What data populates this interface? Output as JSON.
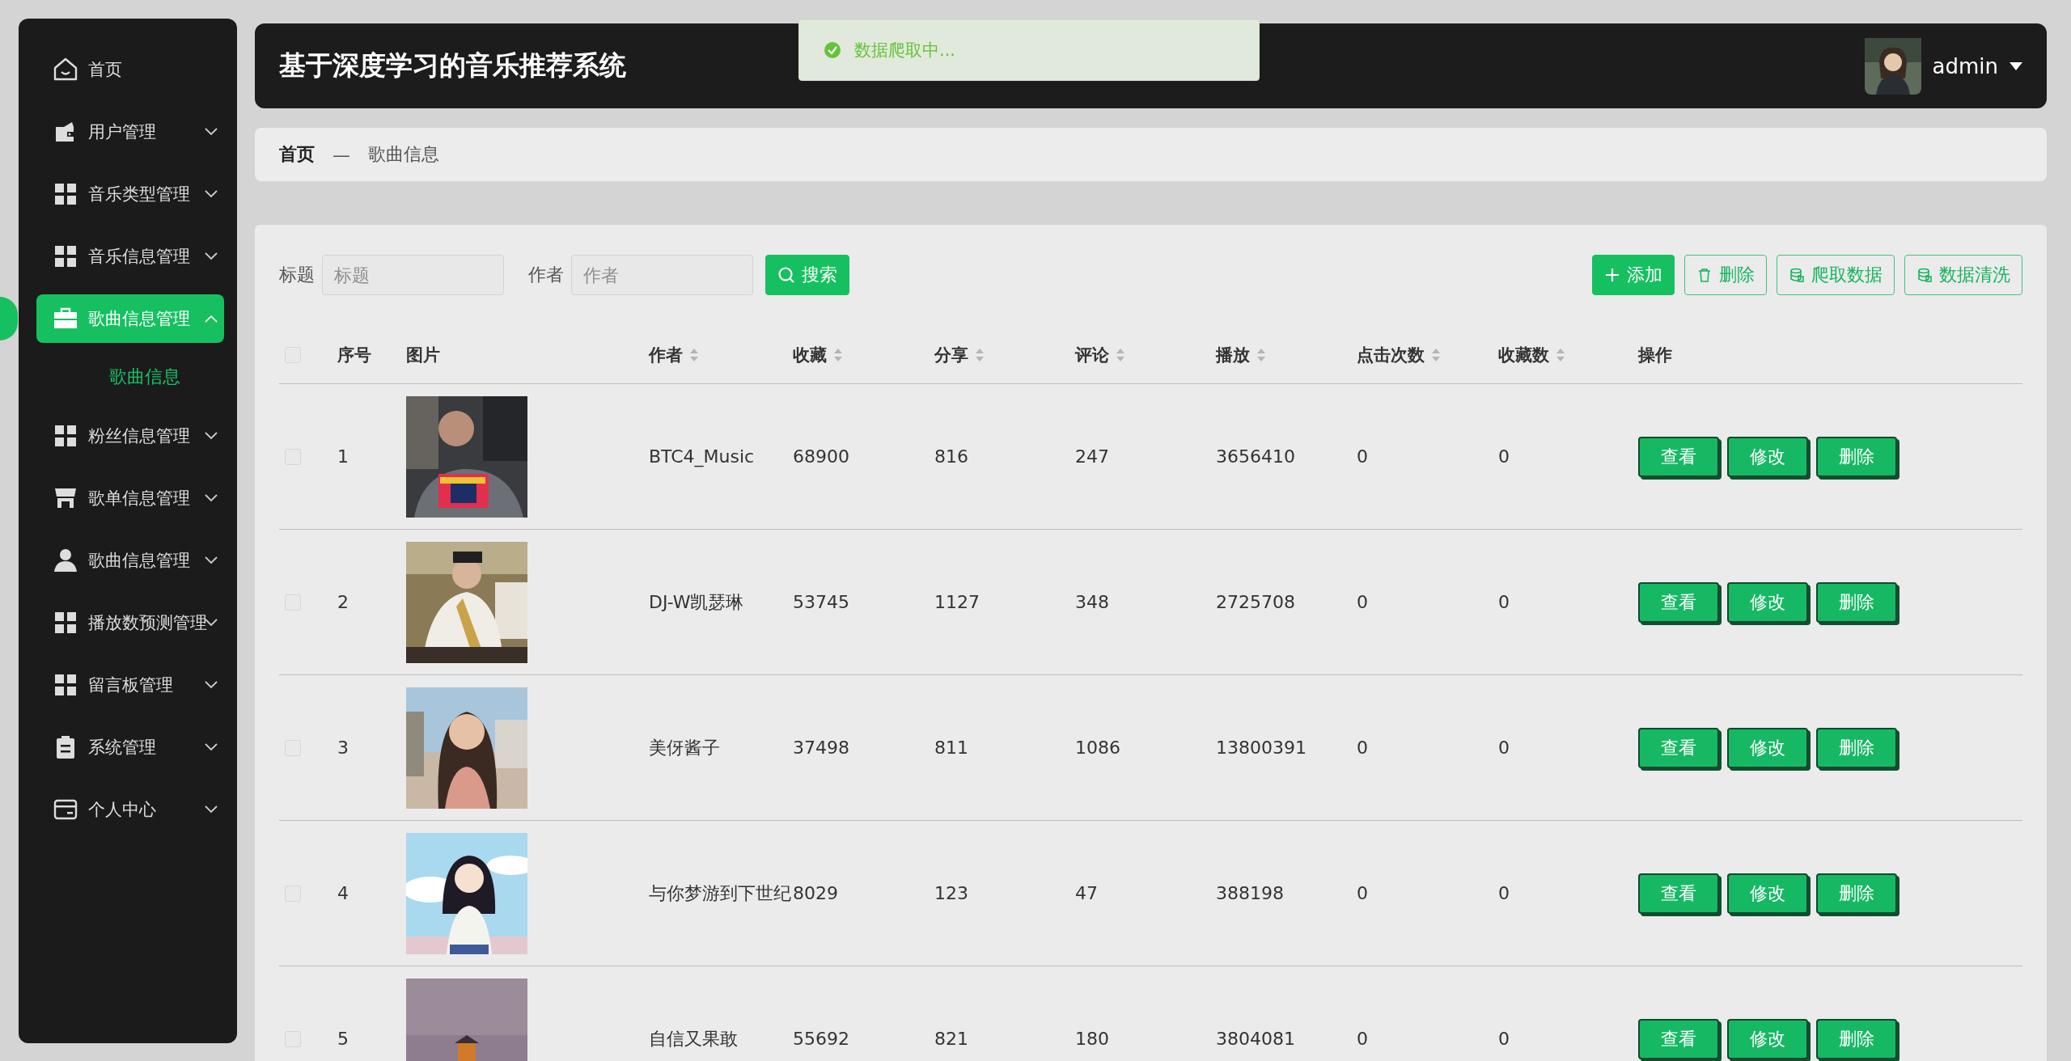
{
  "header": {
    "title": "基于深度学习的音乐推荐系统",
    "user": {
      "name": "admin"
    }
  },
  "toast": {
    "text": "数据爬取中..."
  },
  "breadcrumb": [
    {
      "label": "首页",
      "current": false
    },
    {
      "label": "歌曲信息",
      "current": true
    }
  ],
  "breadcrumb_separator": "—",
  "sidebar": {
    "items": [
      {
        "label": "首页",
        "kind": "home",
        "selected": false
      },
      {
        "label": "用户管理",
        "kind": "wallet",
        "selected": false,
        "expanded": false
      },
      {
        "label": "音乐类型管理",
        "kind": "grid",
        "selected": false,
        "expanded": false
      },
      {
        "label": "音乐信息管理",
        "kind": "grid",
        "selected": false,
        "expanded": false
      },
      {
        "label": "歌曲信息管理",
        "kind": "briefcase",
        "selected": true,
        "expanded": true,
        "children": [
          {
            "label": "歌曲信息",
            "selected": true
          }
        ]
      },
      {
        "label": "粉丝信息管理",
        "kind": "grid",
        "selected": false,
        "expanded": false
      },
      {
        "label": "歌单信息管理",
        "kind": "store",
        "selected": false,
        "expanded": false
      },
      {
        "label": "歌曲信息管理",
        "kind": "person",
        "selected": false,
        "expanded": false
      },
      {
        "label": "播放数预测管理",
        "kind": "grid",
        "selected": false,
        "expanded": false
      },
      {
        "label": "留言板管理",
        "kind": "grid",
        "selected": false,
        "expanded": false
      },
      {
        "label": "系统管理",
        "kind": "clipboard",
        "selected": false,
        "expanded": false
      },
      {
        "label": "个人中心",
        "kind": "card",
        "selected": false,
        "expanded": false
      }
    ]
  },
  "filters": [
    {
      "label": "标题",
      "placeholder": "标题"
    },
    {
      "label": "作者",
      "placeholder": "作者"
    }
  ],
  "search_button": "搜索",
  "toolbar": [
    {
      "label": "添加",
      "kind": "add"
    },
    {
      "label": "删除",
      "kind": "delete"
    },
    {
      "label": "爬取数据",
      "kind": "data"
    },
    {
      "label": "数据清洗",
      "kind": "data"
    }
  ],
  "table": {
    "select_all": {
      "selected": false
    },
    "columns": [
      {
        "label": "序号",
        "sortable": false
      },
      {
        "label": "图片",
        "sortable": false
      },
      {
        "label": "作者",
        "sortable": true
      },
      {
        "label": "收藏",
        "sortable": true
      },
      {
        "label": "分享",
        "sortable": true
      },
      {
        "label": "评论",
        "sortable": true
      },
      {
        "label": "播放",
        "sortable": true
      },
      {
        "label": "点击次数",
        "sortable": true
      },
      {
        "label": "收藏数",
        "sortable": true
      },
      {
        "label": "操作",
        "sortable": false
      }
    ],
    "rows": [
      {
        "selected": false,
        "cells": [
          "1",
          {
            "kind": "picture"
          },
          "BTC4_Music",
          "68900",
          "816",
          "247",
          "3656410",
          "0",
          "0"
        ],
        "actions": [
          "查看",
          "修改",
          "删除"
        ]
      },
      {
        "selected": false,
        "cells": [
          "2",
          {
            "kind": "picture"
          },
          "DJ-W凯瑟琳",
          "53745",
          "1127",
          "348",
          "2725708",
          "0",
          "0"
        ],
        "actions": [
          "查看",
          "修改",
          "删除"
        ]
      },
      {
        "selected": false,
        "cells": [
          "3",
          {
            "kind": "picture"
          },
          "美伢酱子",
          "37498",
          "811",
          "1086",
          "13800391",
          "0",
          "0"
        ],
        "actions": [
          "查看",
          "修改",
          "删除"
        ]
      },
      {
        "selected": false,
        "cells": [
          "4",
          {
            "kind": "picture"
          },
          "与你梦游到下世纪",
          "8029",
          "123",
          "47",
          "388198",
          "0",
          "0"
        ],
        "actions": [
          "查看",
          "修改",
          "删除"
        ]
      },
      {
        "selected": false,
        "cells": [
          "5",
          {
            "kind": "picture"
          },
          "自信又果敢",
          "55692",
          "821",
          "180",
          "3804081",
          "0",
          "0"
        ],
        "actions": [
          "查看",
          "修改",
          "删除"
        ]
      }
    ]
  }
}
